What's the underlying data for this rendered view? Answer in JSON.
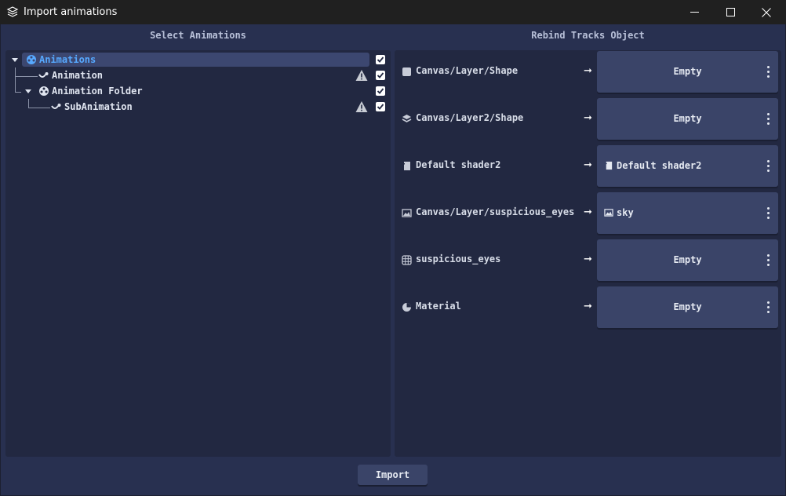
{
  "window": {
    "title": "Import animations"
  },
  "headers": {
    "left": "Select Animations",
    "right": "Rebind Tracks Object"
  },
  "tree": [
    {
      "label": "Animations",
      "icon": "animation-player-icon",
      "selected": true,
      "expanded": true,
      "checked": true,
      "warning": false
    },
    {
      "label": "Animation",
      "icon": "animation-icon",
      "selected": false,
      "checked": true,
      "warning": true
    },
    {
      "label": "Animation Folder",
      "icon": "animation-player-icon",
      "selected": false,
      "expanded": true,
      "checked": true,
      "warning": false
    },
    {
      "label": "SubAnimation",
      "icon": "animation-icon",
      "selected": false,
      "checked": true,
      "warning": true
    }
  ],
  "rebind": [
    {
      "label": "Canvas/Layer/Shape",
      "icon": "shape-icon",
      "value": "Empty",
      "value_icon": ""
    },
    {
      "label": "Canvas/Layer2/Shape",
      "icon": "layers-icon",
      "value": "Empty",
      "value_icon": ""
    },
    {
      "label": "Default shader2",
      "icon": "shader-icon",
      "value": "Default shader2",
      "value_icon": "shader-icon"
    },
    {
      "label": "Canvas/Layer/suspicious_eyes",
      "icon": "image-icon",
      "value": "sky",
      "value_icon": "image-icon"
    },
    {
      "label": "suspicious_eyes",
      "icon": "grid-icon",
      "value": "Empty",
      "value_icon": ""
    },
    {
      "label": "Material",
      "icon": "material-icon",
      "value": "Empty",
      "value_icon": ""
    }
  ],
  "footer": {
    "import_label": "Import"
  },
  "colors": {
    "accent": "#57a9ff",
    "panel": "#222841",
    "background": "#283050",
    "button": "#3a4468",
    "warning": "#c8ccd4"
  }
}
